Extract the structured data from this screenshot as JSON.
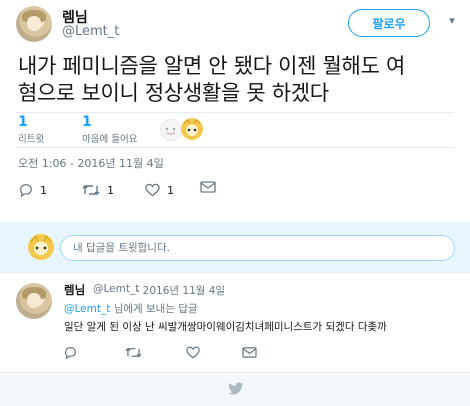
{
  "tweet": {
    "author_name": "렘님",
    "author_handle": "@Lemt_t",
    "follow_label": "팔로우",
    "text_line1": "내가 페미니즘을 알면 안 됐다 이젠 뭘해도 여",
    "text_line2": "혐으로 보이니 정상생활을 못 하겠다",
    "retweets_count": "1",
    "retweets_label": "리트윗",
    "likes_count": "1",
    "likes_label": "마음에 들어요",
    "timestamp": "오전 1:06 - 2016년 11월 4일",
    "reply_count": "1",
    "retweet_action_count": "1",
    "like_action_count": "1"
  },
  "reply_box": {
    "placeholder": "내 답글을 트윗합니다."
  },
  "reply": {
    "author_name": "렘님",
    "author_handle": "@Lemt_t",
    "date": "· 2016년 11월 4일",
    "to_mention": "@Lemt_t",
    "to_suffix": "님에게 보내는 답글",
    "text": "일단 알게 된 이상 난 씨발개쌍마이웨이김치녀페미니스트가 되겠다 다좆까"
  },
  "colors": {
    "accent": "#1da1f2",
    "muted": "#657786",
    "reply_bg": "#e8f5fd"
  }
}
